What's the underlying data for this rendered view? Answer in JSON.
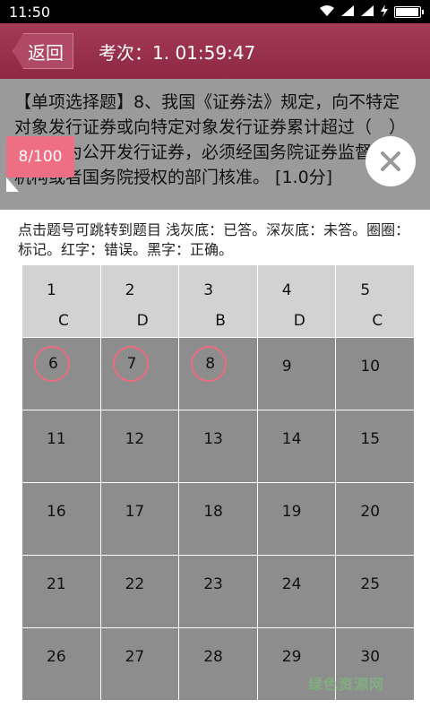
{
  "status_bar": {
    "time": "11:50"
  },
  "header": {
    "back_label": "返回",
    "exam_title": "考次：1. 01:59:47"
  },
  "question": {
    "text": "【单项选择题】8、我国《证券法》规定，向不特定对象发行证券或向特定对象发行证券累计超过（　）人的，为公开发行证券，必须经国务院证券监督管理机构或者国务院授权的部门核准。 [1.0分]"
  },
  "counter": {
    "label": "8/100"
  },
  "legend": {
    "text": "点击题号可跳转到题目 浅灰底：已答。深灰底：未答。圈圈：标记。红字：错误。黑字：正确。"
  },
  "cells": [
    {
      "num": "1",
      "ans": "C",
      "answered": true,
      "marked": false
    },
    {
      "num": "2",
      "ans": "D",
      "answered": true,
      "marked": false
    },
    {
      "num": "3",
      "ans": "B",
      "answered": true,
      "marked": false
    },
    {
      "num": "4",
      "ans": "D",
      "answered": true,
      "marked": false
    },
    {
      "num": "5",
      "ans": "C",
      "answered": true,
      "marked": false
    },
    {
      "num": "6",
      "ans": "",
      "answered": false,
      "marked": true
    },
    {
      "num": "7",
      "ans": "",
      "answered": false,
      "marked": true
    },
    {
      "num": "8",
      "ans": "",
      "answered": false,
      "marked": true
    },
    {
      "num": "9",
      "ans": "",
      "answered": false,
      "marked": false
    },
    {
      "num": "10",
      "ans": "",
      "answered": false,
      "marked": false
    },
    {
      "num": "11",
      "ans": "",
      "answered": false,
      "marked": false
    },
    {
      "num": "12",
      "ans": "",
      "answered": false,
      "marked": false
    },
    {
      "num": "13",
      "ans": "",
      "answered": false,
      "marked": false
    },
    {
      "num": "14",
      "ans": "",
      "answered": false,
      "marked": false
    },
    {
      "num": "15",
      "ans": "",
      "answered": false,
      "marked": false
    },
    {
      "num": "16",
      "ans": "",
      "answered": false,
      "marked": false
    },
    {
      "num": "17",
      "ans": "",
      "answered": false,
      "marked": false
    },
    {
      "num": "18",
      "ans": "",
      "answered": false,
      "marked": false
    },
    {
      "num": "19",
      "ans": "",
      "answered": false,
      "marked": false
    },
    {
      "num": "20",
      "ans": "",
      "answered": false,
      "marked": false
    },
    {
      "num": "21",
      "ans": "",
      "answered": false,
      "marked": false
    },
    {
      "num": "22",
      "ans": "",
      "answered": false,
      "marked": false
    },
    {
      "num": "23",
      "ans": "",
      "answered": false,
      "marked": false
    },
    {
      "num": "24",
      "ans": "",
      "answered": false,
      "marked": false
    },
    {
      "num": "25",
      "ans": "",
      "answered": false,
      "marked": false
    },
    {
      "num": "26",
      "ans": "",
      "answered": false,
      "marked": false
    },
    {
      "num": "27",
      "ans": "",
      "answered": false,
      "marked": false
    },
    {
      "num": "28",
      "ans": "",
      "answered": false,
      "marked": false
    },
    {
      "num": "29",
      "ans": "",
      "answered": false,
      "marked": false
    },
    {
      "num": "30",
      "ans": "",
      "answered": false,
      "marked": false
    }
  ],
  "watermark": {
    "text": "绿色资源网"
  },
  "colors": {
    "header": "#8d2942",
    "accent": "#ee6e84",
    "answered": "#d2d2d2",
    "unanswered": "#8d8d8d"
  }
}
